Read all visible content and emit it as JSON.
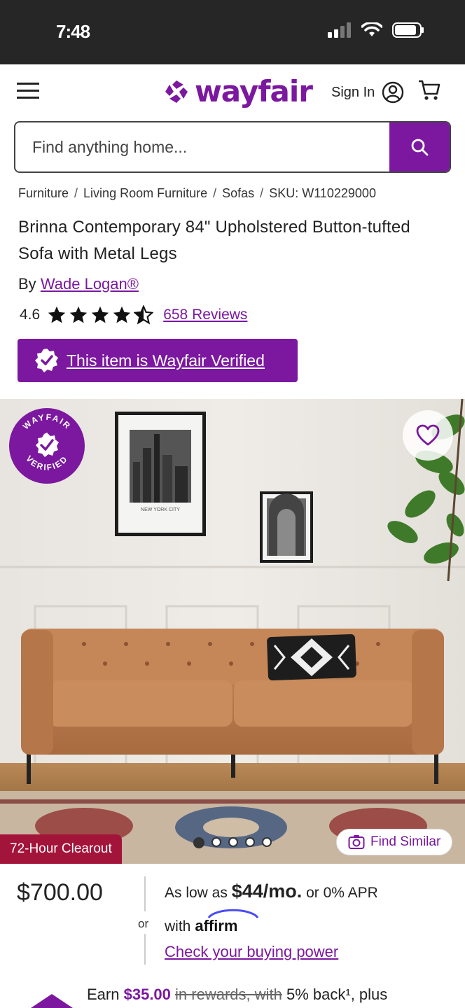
{
  "status_bar": {
    "time": "7:48"
  },
  "header": {
    "logo_text": "wayfair",
    "sign_in_label": "Sign In"
  },
  "search": {
    "placeholder": "Find anything home..."
  },
  "breadcrumb": {
    "items": [
      "Furniture",
      "Living Room Furniture",
      "Sofas"
    ],
    "sku": "SKU: W110229000"
  },
  "product": {
    "title": "Brinna Contemporary 84\" Upholstered Button-tufted Sofa with Metal Legs",
    "brand_prefix": "By",
    "brand_name": "Wade Logan®",
    "rating": "4.6",
    "reviews_label": "658 Reviews",
    "verified_label": "This item is Wayfair Verified"
  },
  "hero": {
    "badge_top": "WAYFAIR",
    "badge_bottom": "VERIFIED",
    "clearout_label": "72-Hour Clearout",
    "find_similar_label": "Find Similar",
    "dot_count": 5,
    "active_dot": 0,
    "artwork_caption": "NEW YORK CITY"
  },
  "pricing": {
    "price": "$700.00",
    "or": "or",
    "as_low_as": "As low as",
    "monthly": "$44/mo.",
    "apr": "or 0% APR",
    "with": "with",
    "affirm": "affirm",
    "check_link": "Check your buying power",
    "earn_prefix": "Earn",
    "earn_amount": "$35.00",
    "earn_middle": "in rewards, with",
    "earn_suffix": "5% back¹, plus"
  },
  "colors": {
    "brand_purple": "#7b189f",
    "clearout_red": "#a3143a",
    "status_bar": "#262626"
  }
}
